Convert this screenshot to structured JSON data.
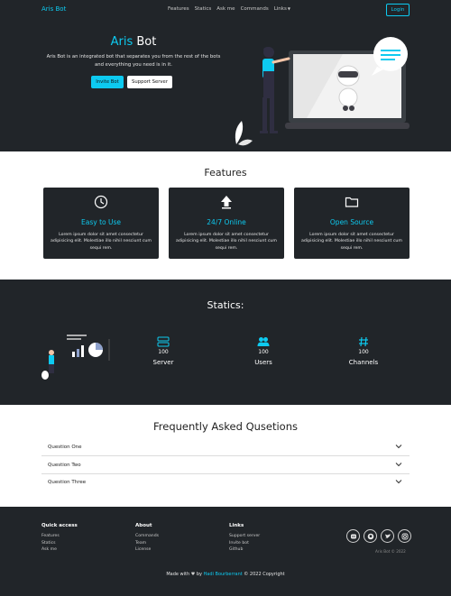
{
  "nav": {
    "brand": "Aris Bot",
    "links": [
      "Features",
      "Statics",
      "Ask me",
      "Commands",
      "Links"
    ],
    "login": "Login"
  },
  "hero": {
    "title_accent": "Aris",
    "title_rest": " Bot",
    "description": "Aris Bot is an integrated bot that separates you from the rest of the bots and everything you need is in it.",
    "invite_label": "Invite Bot",
    "support_label": "Support Server"
  },
  "features": {
    "title": "Features",
    "cards": [
      {
        "icon": "clock-icon",
        "title": "Easy to Use",
        "desc": "Lorem ipsum dolor sit amet consectetur adipisicing elit. Molestiae illo nihil nesciunt cum sequi rem."
      },
      {
        "icon": "upload-arrow-icon",
        "title": "24/7 Online",
        "desc": "Lorem ipsum dolor sit amet consectetur adipisicing elit. Molestiae illo nihil nesciunt cum sequi rem."
      },
      {
        "icon": "folder-icon",
        "title": "Open Source",
        "desc": "Lorem ipsum dolor sit amet consectetur adipisicing elit. Molestiae illo nihil nesciunt cum sequi rem."
      }
    ]
  },
  "statics": {
    "title": "Statics:",
    "items": [
      {
        "icon": "server-icon",
        "value": "100",
        "label": "Server"
      },
      {
        "icon": "users-icon",
        "value": "100",
        "label": "Users"
      },
      {
        "icon": "hash-icon",
        "value": "100",
        "label": "Channels"
      }
    ]
  },
  "faq": {
    "title": "Frequently Asked Qusetions",
    "questions": [
      "Question One",
      "Question Two",
      "Question Three"
    ]
  },
  "footer": {
    "cols": [
      {
        "head": "Quick access",
        "links": [
          "Features",
          "Statics",
          "Ask me"
        ]
      },
      {
        "head": "About",
        "links": [
          "Commands",
          "Team",
          "License"
        ]
      },
      {
        "head": "Links",
        "links": [
          "Support server",
          "Invite bot",
          "Github"
        ]
      }
    ],
    "socials": [
      "discord-icon",
      "github-icon",
      "twitter-icon",
      "instagram-icon"
    ],
    "copy_small": "Aris Bot © 2022",
    "made_prefix": "Made with ",
    "made_by": " by ",
    "author": "Hadi Bourberrant",
    "made_suffix": " © 2022 Copyright"
  },
  "colors": {
    "accent": "#0dcaf0",
    "dark": "#212529",
    "light": "#ffffff"
  }
}
